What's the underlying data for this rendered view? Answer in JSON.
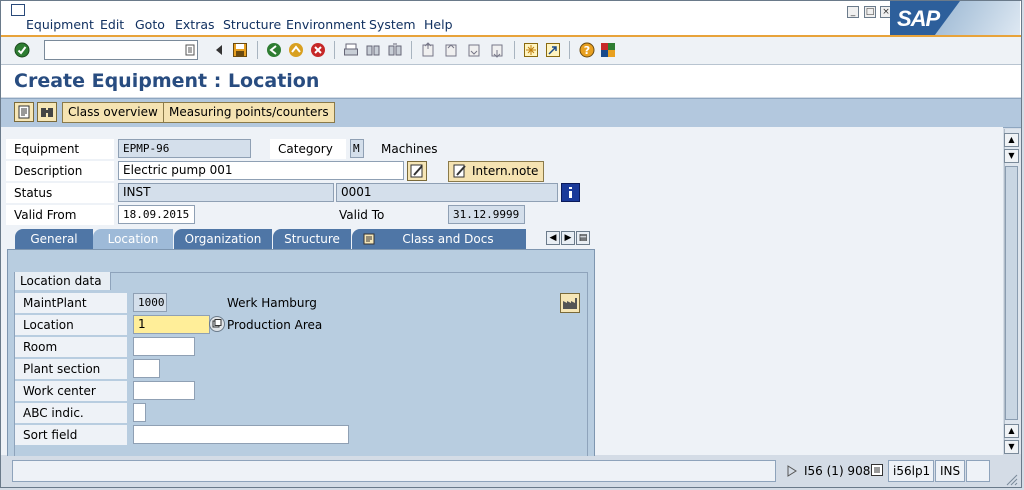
{
  "menu": {
    "items": [
      "Equipment",
      "Edit",
      "Goto",
      "Extras",
      "Structure",
      "Environment",
      "System",
      "Help"
    ]
  },
  "brand": {
    "logo_text": "SAP"
  },
  "toolbar": {
    "command_field_value": ""
  },
  "title": "Create Equipment : Location",
  "app_toolbar": {
    "class_overview": "Class overview",
    "measuring_points": "Measuring points/counters"
  },
  "header": {
    "equipment_label": "Equipment",
    "equipment_value": "EPMP-96",
    "category_label": "Category",
    "category_value": "M",
    "category_text": "Machines",
    "description_label": "Description",
    "description_value": "Electric pump 001",
    "intern_note": "Intern.note",
    "status_label": "Status",
    "status_value": "INST",
    "status_value2": "0001",
    "valid_from_label": "Valid From",
    "valid_from_value": "18.09.2015",
    "valid_to_label": "Valid To",
    "valid_to_value": "31.12.9999"
  },
  "tabs": [
    {
      "label": "General",
      "active": false
    },
    {
      "label": "Location",
      "active": true
    },
    {
      "label": "Organization",
      "active": false
    },
    {
      "label": "Structure",
      "active": false
    },
    {
      "label": "Class and Docs",
      "active": false
    }
  ],
  "location_data": {
    "group_title": "Location data",
    "maint_plant_label": "MaintPlant",
    "maint_plant_value": "1000",
    "maint_plant_text": "Werk Hamburg",
    "location_label": "Location",
    "location_value": "1",
    "location_text": "Production Area",
    "room_label": "Room",
    "room_value": "",
    "plant_section_label": "Plant section",
    "plant_section_value": "",
    "work_center_label": "Work center",
    "work_center_value": "",
    "abc_label": "ABC indic.",
    "abc_value": "",
    "sort_field_label": "Sort field",
    "sort_field_value": ""
  },
  "statusbar": {
    "session": "I56 (1) 908",
    "server": "i56lp1",
    "mode": "INS"
  },
  "colors": {
    "accent": "#e8a33a",
    "title": "#284c80",
    "tab_active": "#9ebad8",
    "tab_inactive": "#4f76a6",
    "required_field": "#ffee99"
  }
}
